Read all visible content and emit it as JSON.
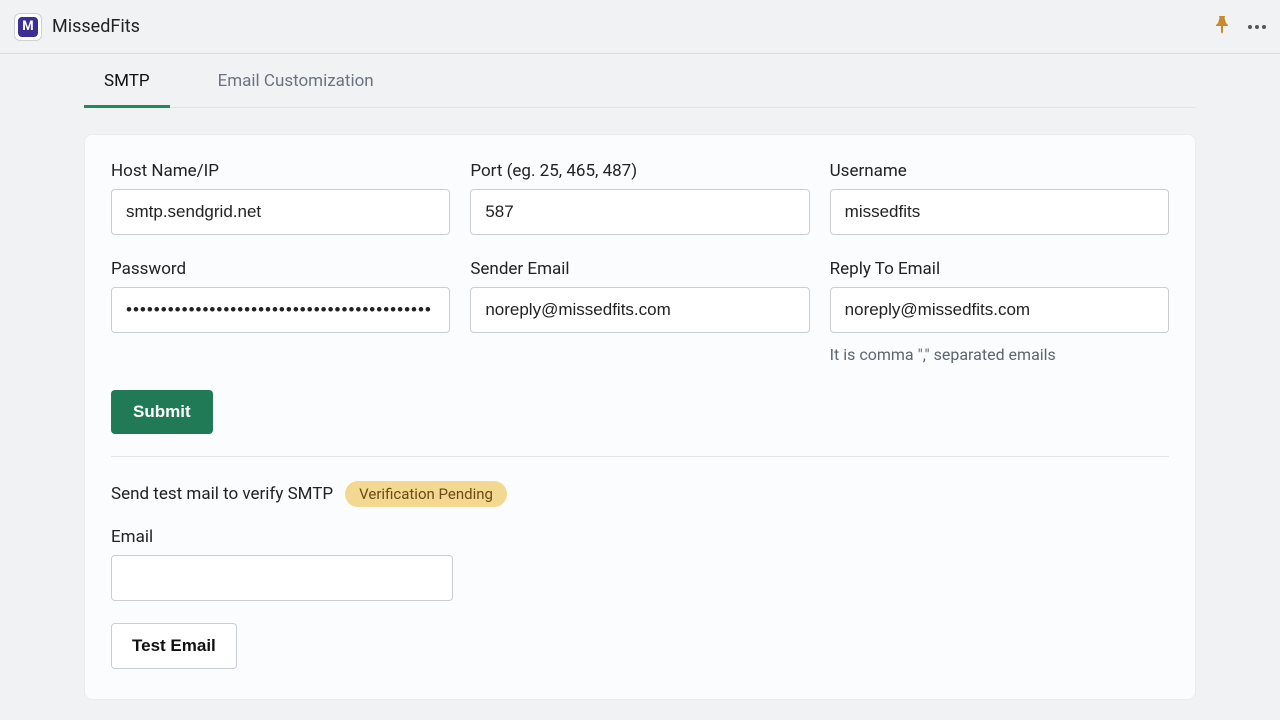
{
  "app": {
    "title": "MissedFits",
    "logo_letter": "M"
  },
  "tabs": {
    "smtp": "SMTP",
    "email_customization": "Email Customization"
  },
  "form": {
    "host_label": "Host Name/IP",
    "host_value": "smtp.sendgrid.net",
    "port_label": "Port (eg. 25, 465, 487)",
    "port_value": "587",
    "username_label": "Username",
    "username_value": "missedfits",
    "password_label": "Password",
    "password_value": "••••••••••••••••••••••••••••••••••••••••••••",
    "sender_label": "Sender Email",
    "sender_value": "noreply@missedfits.com",
    "reply_label": "Reply To Email",
    "reply_value": "noreply@missedfits.com",
    "reply_helper": "It is comma \",\" separated emails",
    "submit": "Submit"
  },
  "test": {
    "heading": "Send test mail to verify SMTP",
    "badge": "Verification Pending",
    "email_label": "Email",
    "email_value": "",
    "button": "Test Email"
  }
}
